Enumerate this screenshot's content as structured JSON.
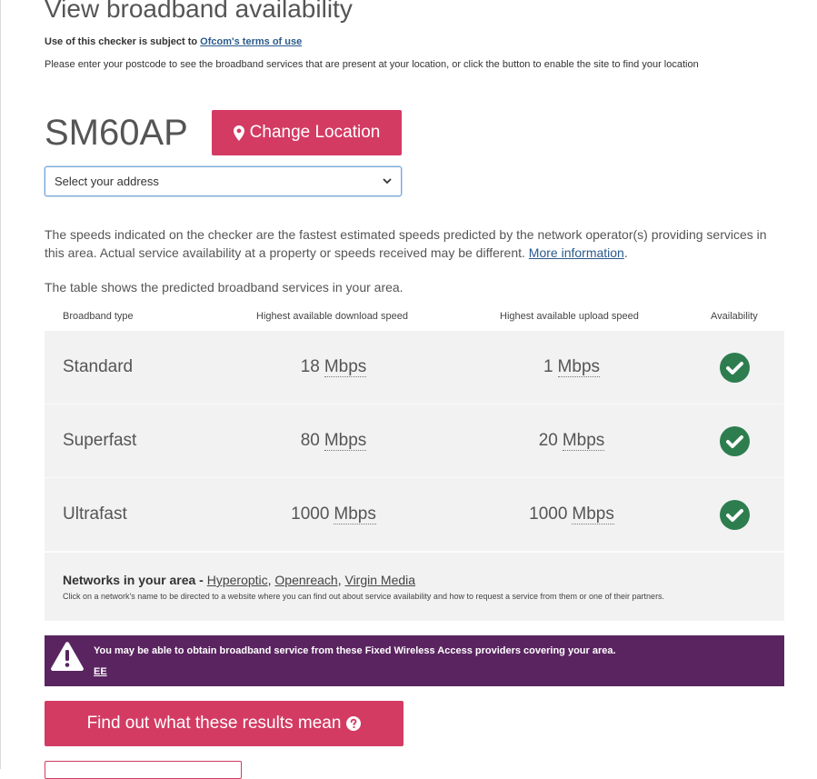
{
  "header": {
    "title": "View broadband availability",
    "terms_prefix": "Use of this checker is subject to ",
    "terms_link": "Ofcom's terms of use",
    "intro": "Please enter your postcode to see the broadband services that are present at your location, or click the button to enable the site to find your location"
  },
  "location": {
    "postcode": "SM60AP",
    "change_label": "Change Location",
    "address_selected": "Select your address"
  },
  "info": {
    "speeds_note": "The speeds indicated on the checker are the fastest estimated speeds predicted by the network operator(s) providing services in this area. Actual service availability at a property or speeds received may be different. ",
    "more_info_link": "More information",
    "more_info_suffix": ".",
    "table_intro": "The table shows the predicted broadband services in your area."
  },
  "table": {
    "headers": [
      "Broadband type",
      "Highest available download speed",
      "Highest available upload speed",
      "Availability"
    ],
    "unit": "Mbps",
    "rows": [
      {
        "type": "Standard",
        "download": "18",
        "upload": "1",
        "available": true
      },
      {
        "type": "Superfast",
        "download": "80",
        "upload": "20",
        "available": true
      },
      {
        "type": "Ultrafast",
        "download": "1000",
        "upload": "1000",
        "available": true
      }
    ]
  },
  "networks": {
    "label": "Networks in your area - ",
    "items": [
      "Hyperoptic",
      "Openreach",
      "Virgin Media"
    ],
    "separator": ", ",
    "note": "Click on a network's name to be directed to a website where you can find out about service availability and how to request a service from them or one of their partners."
  },
  "fwa": {
    "message": "You may be able to obtain broadband service from these Fixed Wireless Access providers covering your area.",
    "providers": [
      "EE"
    ]
  },
  "actions": {
    "results_label": "Find out what these results mean"
  },
  "colors": {
    "accent": "#d33b63",
    "banner": "#5a2460",
    "check": "#2e7d4f"
  }
}
